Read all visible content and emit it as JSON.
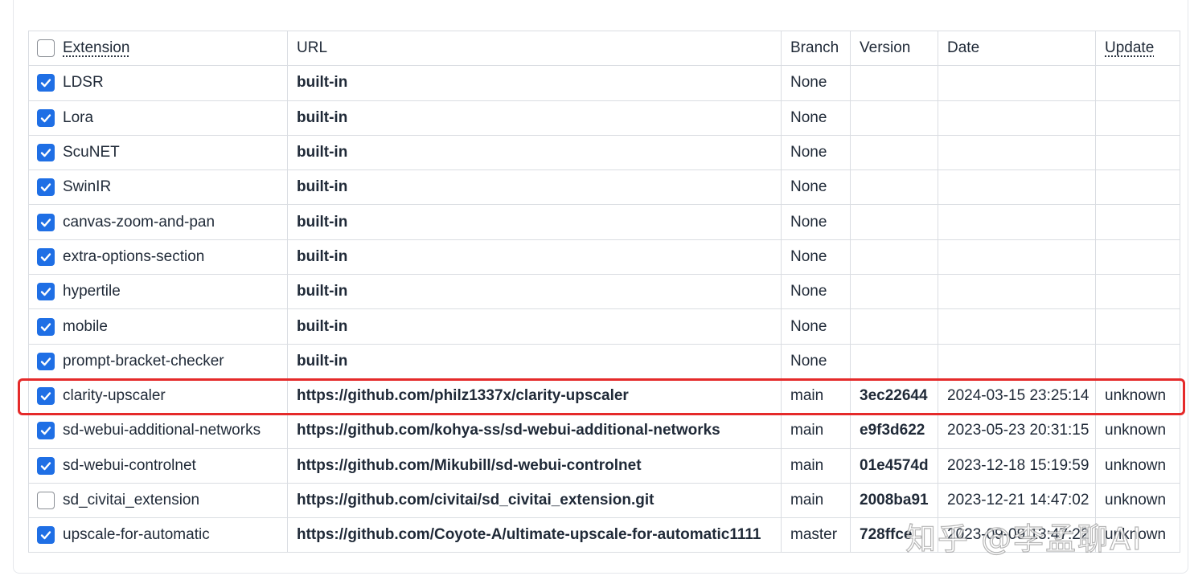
{
  "columns": {
    "extension": "Extension",
    "url": "URL",
    "branch": "Branch",
    "version": "Version",
    "date": "Date",
    "update": "Update"
  },
  "select_all_checked": false,
  "rows": [
    {
      "checked": true,
      "name": "LDSR",
      "url": "built-in",
      "branch": "None",
      "version": "",
      "date": "",
      "update": ""
    },
    {
      "checked": true,
      "name": "Lora",
      "url": "built-in",
      "branch": "None",
      "version": "",
      "date": "",
      "update": ""
    },
    {
      "checked": true,
      "name": "ScuNET",
      "url": "built-in",
      "branch": "None",
      "version": "",
      "date": "",
      "update": ""
    },
    {
      "checked": true,
      "name": "SwinIR",
      "url": "built-in",
      "branch": "None",
      "version": "",
      "date": "",
      "update": ""
    },
    {
      "checked": true,
      "name": "canvas-zoom-and-pan",
      "url": "built-in",
      "branch": "None",
      "version": "",
      "date": "",
      "update": ""
    },
    {
      "checked": true,
      "name": "extra-options-section",
      "url": "built-in",
      "branch": "None",
      "version": "",
      "date": "",
      "update": ""
    },
    {
      "checked": true,
      "name": "hypertile",
      "url": "built-in",
      "branch": "None",
      "version": "",
      "date": "",
      "update": ""
    },
    {
      "checked": true,
      "name": "mobile",
      "url": "built-in",
      "branch": "None",
      "version": "",
      "date": "",
      "update": ""
    },
    {
      "checked": true,
      "name": "prompt-bracket-checker",
      "url": "built-in",
      "branch": "None",
      "version": "",
      "date": "",
      "update": ""
    },
    {
      "checked": true,
      "name": "clarity-upscaler",
      "url": "https://github.com/philz1337x/clarity-upscaler",
      "branch": "main",
      "version": "3ec22644",
      "date": "2024-03-15 23:25:14",
      "update": "unknown"
    },
    {
      "checked": true,
      "name": "sd-webui-additional-networks",
      "url": "https://github.com/kohya-ss/sd-webui-additional-networks",
      "branch": "main",
      "version": "e9f3d622",
      "date": "2023-05-23 20:31:15",
      "update": "unknown"
    },
    {
      "checked": true,
      "name": "sd-webui-controlnet",
      "url": "https://github.com/Mikubill/sd-webui-controlnet",
      "branch": "main",
      "version": "01e4574d",
      "date": "2023-12-18 15:19:59",
      "update": "unknown"
    },
    {
      "checked": false,
      "name": "sd_civitai_extension",
      "url": "https://github.com/civitai/sd_civitai_extension.git",
      "branch": "main",
      "version": "2008ba91",
      "date": "2023-12-21 14:47:02",
      "update": "unknown"
    },
    {
      "checked": true,
      "name": "upscale-for-automatic",
      "url": "https://github.com/Coyote-A/ultimate-upscale-for-automatic1111",
      "branch": "master",
      "version": "728ffce",
      "date": "2023-09-09 13:47:22",
      "update": "unknown"
    }
  ],
  "watermark": "知乎 @李孟聊AI",
  "colors": {
    "checkbox_on": "#1f6fe5",
    "highlight": "#e52a2a"
  }
}
